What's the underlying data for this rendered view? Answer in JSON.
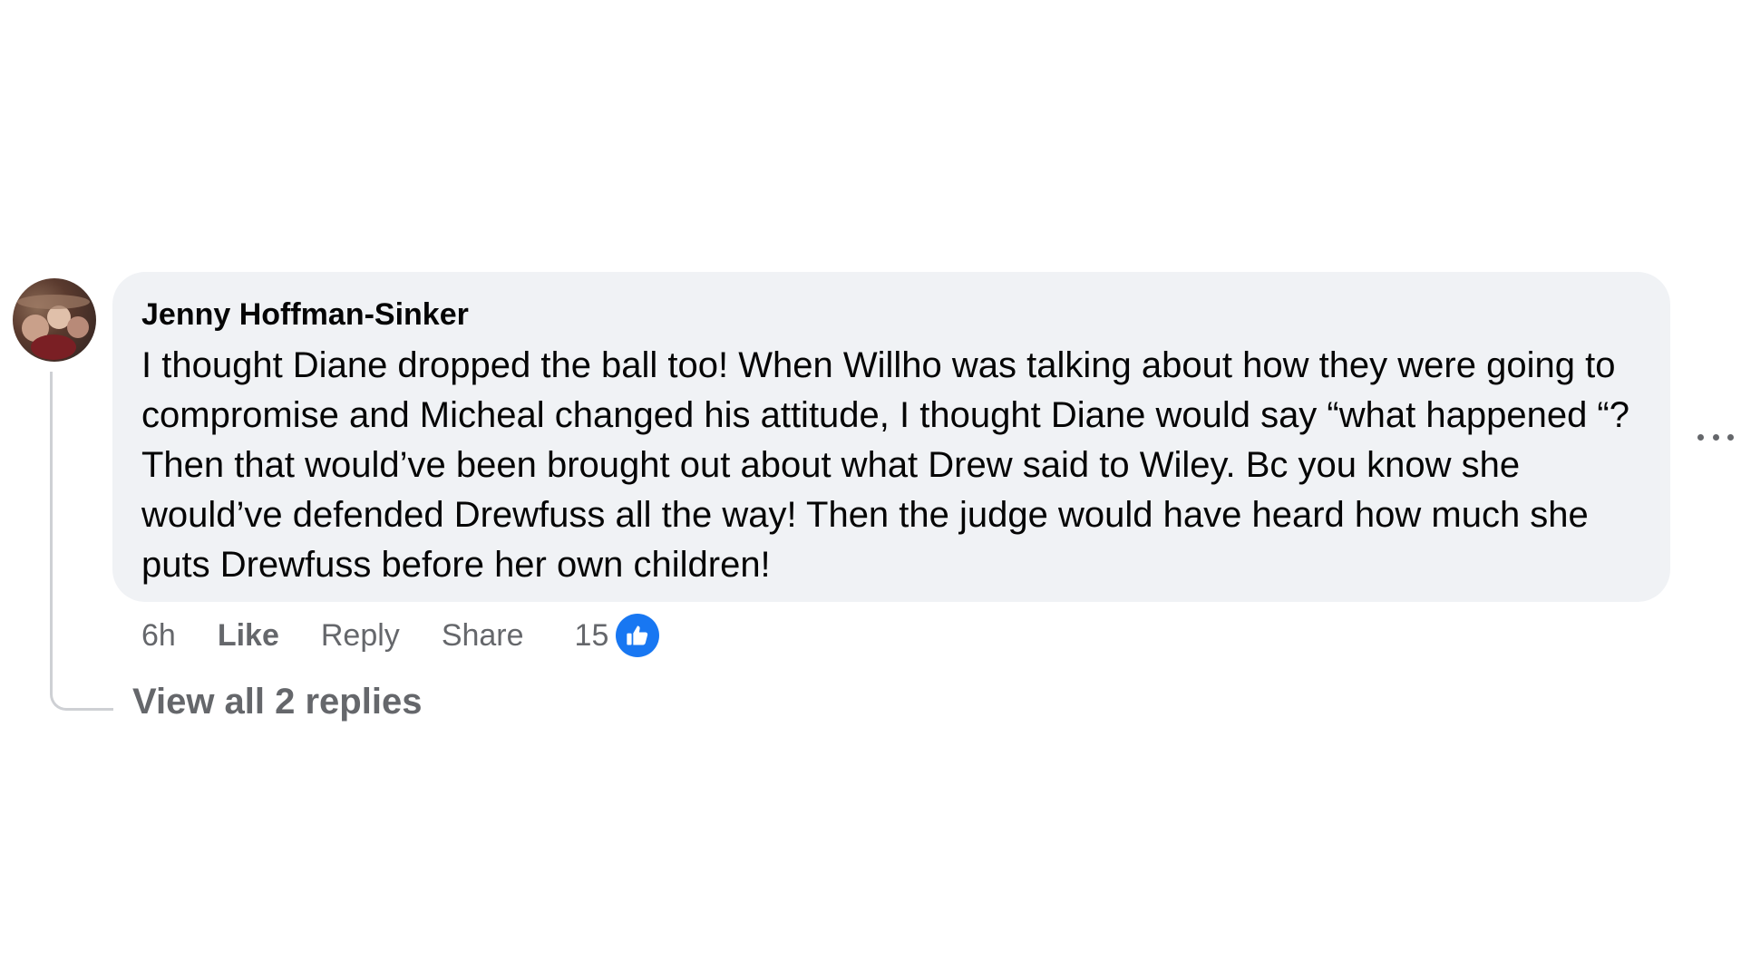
{
  "comment": {
    "author": "Jenny Hoffman-Sinker",
    "text": "I thought Diane dropped the ball too! When Willho was talking about how they were going to compromise and Micheal changed his attitude, I thought Diane would say “what happened “? Then that would’ve been brought out about what Drew said to Wiley. Bc you know she would’ve defended Drewfuss all the way! Then the judge would have heard how much she puts Drewfuss before her own children!",
    "time": "6h",
    "like_label": "Like",
    "reply_label": "Reply",
    "share_label": "Share",
    "reaction_count": "15",
    "reaction_icon": "thumbs-up-icon",
    "view_replies_label": "View all 2 replies"
  },
  "colors": {
    "bubble": "#f0f2f5",
    "secondary_text": "#65676b",
    "like_blue": "#1877f2"
  }
}
